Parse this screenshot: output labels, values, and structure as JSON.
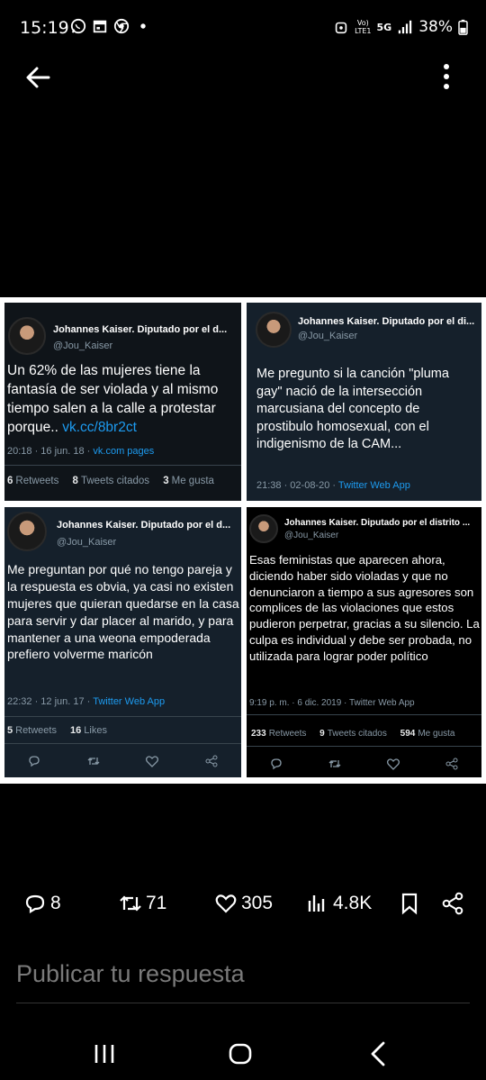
{
  "status_bar": {
    "time": "15:19",
    "net_volte": "Vo)",
    "net_lte": "LTE1",
    "net_5g": "5G",
    "battery": "38%"
  },
  "tweets": [
    {
      "name": "Johannes Kaiser. Diputado por el d...",
      "handle": "@Jou_Kaiser",
      "text": "Un 62% de las mujeres tiene la fantasía de ser violada y al mismo tiempo salen a la calle a protestar porque..",
      "link": "vk.cc/8br2ct",
      "meta": "20:18 · 16 jun. 18 · ",
      "meta_link": "vk.com pages",
      "stats": [
        {
          "count": "6",
          "label": "Retweets"
        },
        {
          "count": "8",
          "label": "Tweets citados"
        },
        {
          "count": "3",
          "label": "Me gusta"
        }
      ]
    },
    {
      "name": "Johannes Kaiser. Diputado por el di...",
      "handle": "@Jou_Kaiser",
      "text": "Me pregunto si la canción \"pluma gay\" nació de la intersección marcusiana del concepto de prostibulo homosexual, con el indigenismo de la CAM...",
      "meta": "21:38 · 02-08-20 · ",
      "meta_link": "Twitter Web App"
    },
    {
      "name": "Johannes Kaiser. Diputado por el d...",
      "handle": "@Jou_Kaiser",
      "text": "Me preguntan por qué no tengo pareja y la respuesta es obvia, ya casi no existen mujeres que quieran quedarse en la casa para servir y dar placer al marido, y para mantener a una weona empoderada prefiero volverme maricón",
      "meta": "22:32 · 12 jun. 17 · ",
      "meta_link": "Twitter Web App",
      "stats": [
        {
          "count": "5",
          "label": "Retweets"
        },
        {
          "count": "16",
          "label": "Likes"
        }
      ]
    },
    {
      "name": "Johannes Kaiser. Diputado por el distrito ...",
      "handle": "@Jou_Kaiser",
      "text": "Esas feministas que aparecen ahora, diciendo haber sido violadas y que no denunciaron a tiempo a sus agresores son complices de las violaciones que estos pudieron perpetrar, gracias a su silencio. La culpa es individual y debe ser probada, no utilizada para lograr poder político",
      "meta": "9:19 p. m. · 6 dic. 2019 · Twitter Web App",
      "stats": [
        {
          "count": "233",
          "label": "Retweets"
        },
        {
          "count": "9",
          "label": "Tweets citados"
        },
        {
          "count": "594",
          "label": "Me gusta"
        }
      ]
    }
  ],
  "actions": {
    "replies": "8",
    "reposts": "71",
    "likes": "305",
    "views": "4.8K"
  },
  "reply": {
    "placeholder": "Publicar tu respuesta"
  }
}
